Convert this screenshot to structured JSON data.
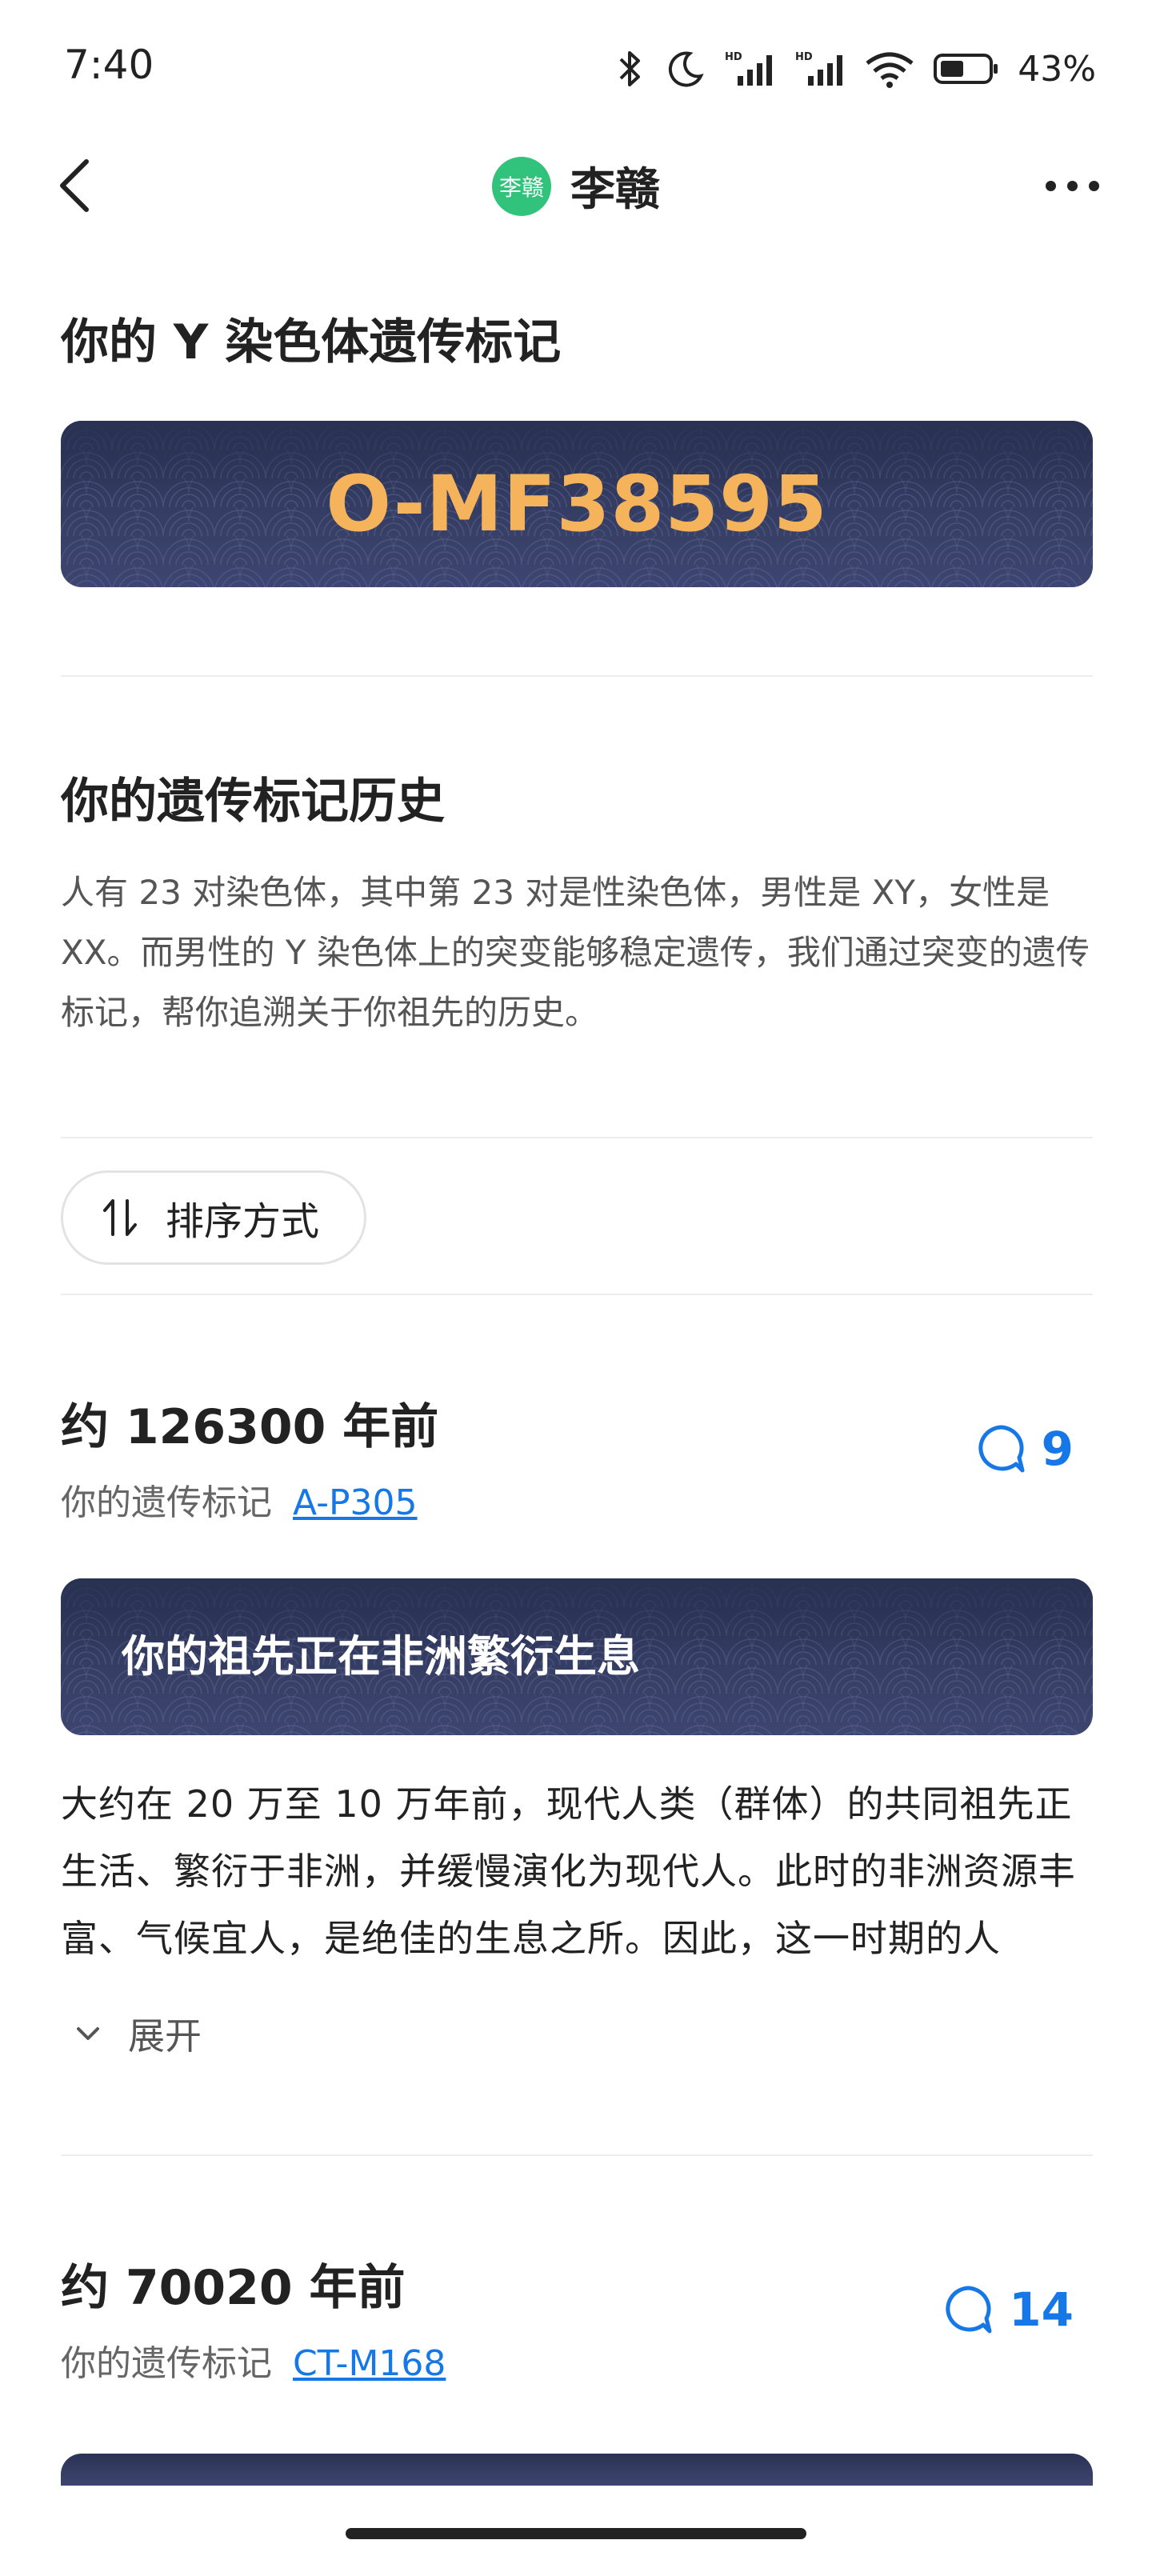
{
  "status_bar": {
    "time": "7:40",
    "battery": "43%"
  },
  "nav": {
    "avatar_text": "李赣",
    "title": "李赣"
  },
  "haplogroup": {
    "heading": "你的 Y 染色体遗传标记",
    "value": "O-MF38595"
  },
  "history": {
    "heading": "你的遗传标记历史",
    "description": "人有 23 对染色体，其中第 23 对是性染色体，男性是 XY，女性是 XX。而男性的 Y 染色体上的突变能够稳定遗传，我们通过突变的遗传标记，帮你追溯关于你祖先的历史。",
    "sort_label": "排序方式"
  },
  "entries": [
    {
      "year": "约 126300 年前",
      "marker_label": "你的遗传标记",
      "marker": "A-P305",
      "comments": "9",
      "banner_title": "你的祖先正在非洲繁衍生息",
      "text": "大约在 20 万至 10 万年前，现代人类（群体）的共同祖先正生活、繁衍于非洲，并缓慢演化为现代人。此时的非洲资源丰富、气候宜人，是绝佳的生息之所。因此，这一时期的人",
      "expand_label": "展开"
    },
    {
      "year": "约 70020 年前",
      "marker_label": "你的遗传标记",
      "marker": "CT-M168",
      "comments": "14"
    }
  ],
  "colors": {
    "accent": "#1677e6",
    "banner_bg": "#2f3759",
    "haplo_text": "#f5b35b",
    "avatar_bg": "#31c27c"
  }
}
